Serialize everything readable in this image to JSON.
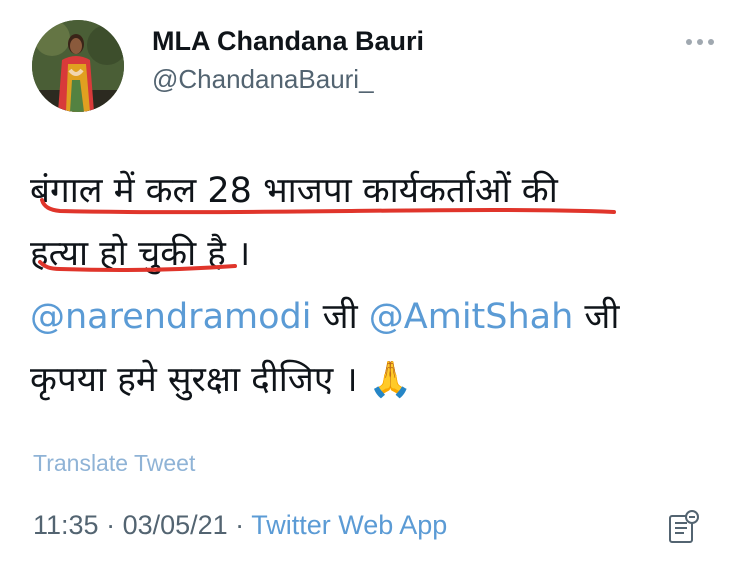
{
  "user": {
    "display_name": "MLA Chandana Bauri",
    "handle": "@ChandanaBauri_"
  },
  "tweet": {
    "line1": "बंगाल में कल 28 भाजपा कार्यकर्ताओं की",
    "line2": "हत्या हो चुकी है ।",
    "mention1": "@narendramodi",
    "ji1": " जी ",
    "mention2": "@AmitShah",
    "ji2": " जी",
    "line4": "कृपया हमे सुरक्षा दीजिए । 🙏"
  },
  "translate_label": "Translate Tweet",
  "meta": {
    "time": "11:35",
    "separator1": " · ",
    "date": "03/05/21",
    "separator2": " · ",
    "source": "Twitter Web App"
  },
  "icons": {
    "more": "more-horizontal-icon",
    "analytics": "tweet-analytics-icon",
    "annotation": "red-hand-drawn-underline"
  },
  "colors": {
    "link": "#5b9bd5",
    "secondary_text": "#536471",
    "annotation": "#e0352b"
  }
}
